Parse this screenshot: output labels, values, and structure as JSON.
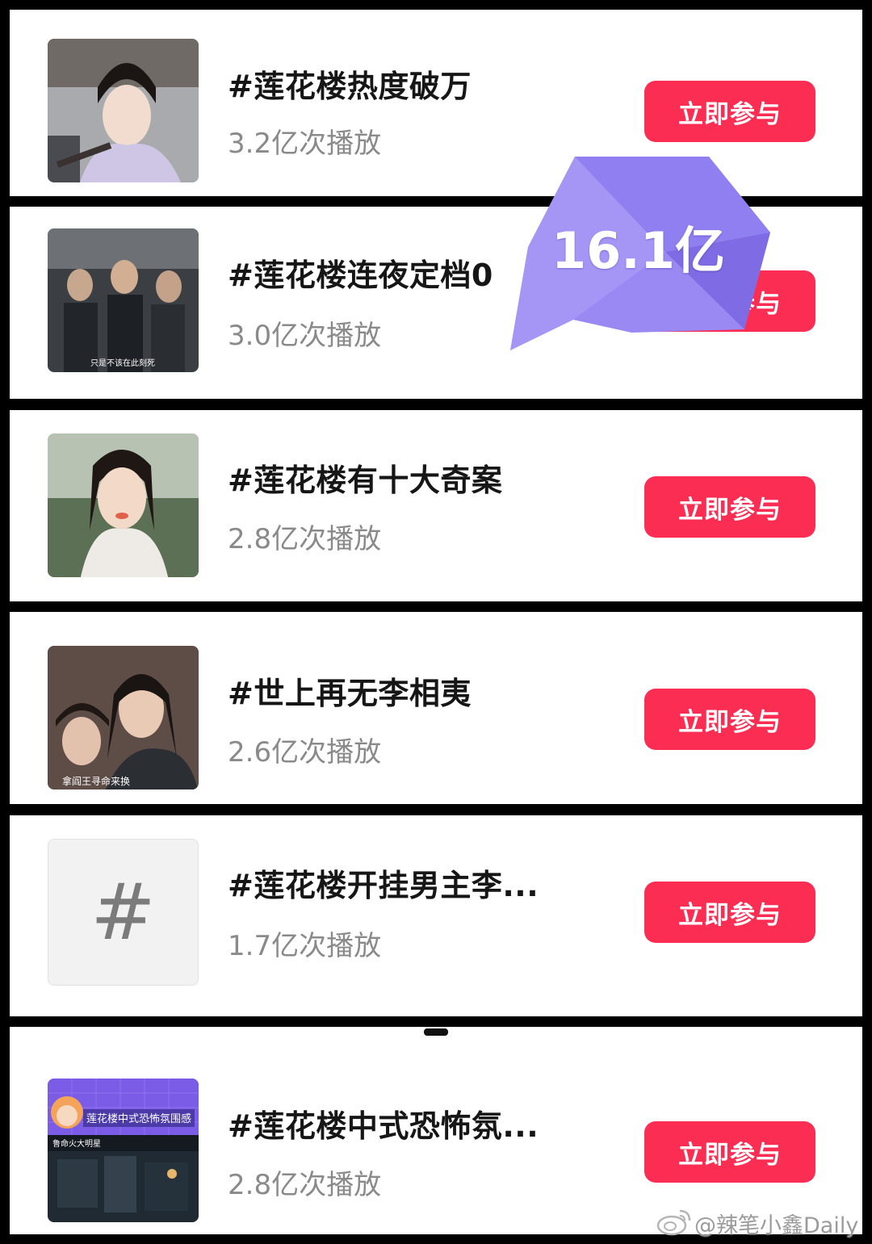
{
  "topics": [
    {
      "title": "#莲花楼热度破万",
      "plays": "3.2亿次播放",
      "button": "立即参与"
    },
    {
      "title": "#莲花楼连夜定档0",
      "plays": "3.0亿次播放",
      "button": "立即参与"
    },
    {
      "title": "#莲花楼有十大奇案",
      "plays": "2.8亿次播放",
      "button": "立即参与"
    },
    {
      "title": "#世上再无李相夷",
      "plays": "2.6亿次播放",
      "button": "立即参与"
    },
    {
      "title": "#莲花楼开挂男主李...",
      "plays": "1.7亿次播放",
      "button": "立即参与"
    },
    {
      "title": "#莲花楼中式恐怖氛...",
      "plays": "2.8亿次播放",
      "button": "立即参与"
    }
  ],
  "thumbnails": {
    "t2_caption": "只是不该在此刻死",
    "t4_caption": "拿阎王寻命来换",
    "t5_hash": "#",
    "t6_banner": "莲花楼中式恐怖氛围感",
    "t6_subcaption": "鲁命火大明星"
  },
  "badge": {
    "text": "16.1亿"
  },
  "watermark": "@辣笔小鑫Daily",
  "colors": {
    "button": "#fb2d52",
    "badge": "#8f7ff0",
    "background": "#000000"
  }
}
